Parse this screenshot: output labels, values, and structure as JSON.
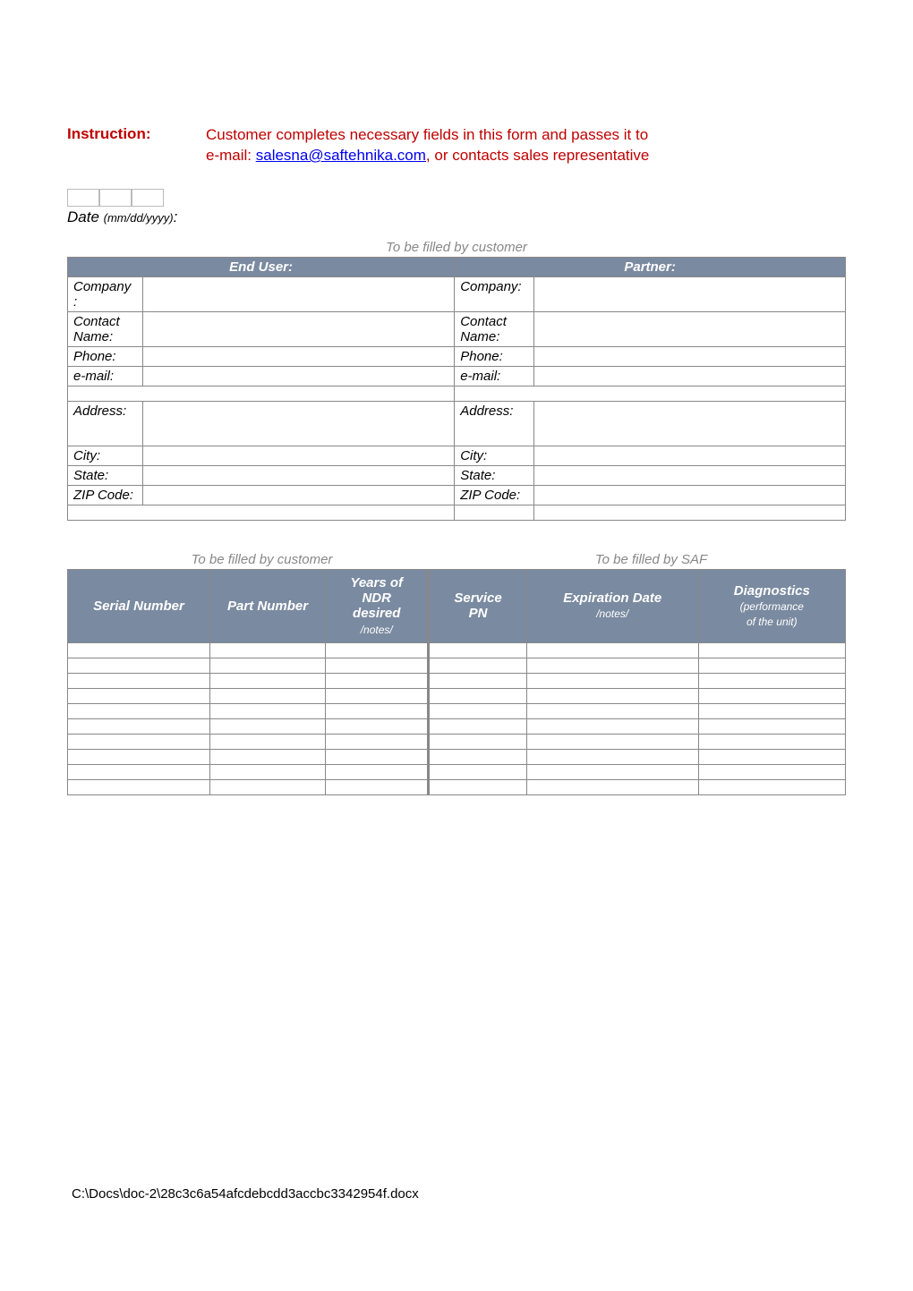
{
  "instruction": {
    "label": "Instruction:",
    "line1_prefix": "Customer completes necessary fields in this form and passes it to",
    "line2_prefix": "e-mail: ",
    "email": "salesna@saftehnika.com",
    "line2_suffix": ", or contacts sales representative"
  },
  "date": {
    "label": "Date ",
    "sub": "(mm/dd/yyyy)",
    "colon": ":"
  },
  "notes": {
    "customer": "To be filled by customer",
    "saf": "To be filled by SAF"
  },
  "contact": {
    "end_user_header": "End User:",
    "partner_header": "Partner:",
    "labels": {
      "company_colon": "Company:",
      "company_split": "Company :",
      "contact_name": "Contact Name:",
      "phone": "Phone:",
      "email": "e-mail:",
      "address": "Address:",
      "city": "City:",
      "state": "State:",
      "zip": "ZIP Code:"
    }
  },
  "items": {
    "headers": {
      "serial": "Serial Number",
      "part": "Part Number",
      "years_l1": "Years of",
      "years_l2": "NDR",
      "years_l3": "desired",
      "years_sub": "/notes/",
      "service_l1": "Service",
      "service_l2": "PN",
      "expiration": "Expiration Date",
      "expiration_sub": "/notes/",
      "diag_l1": "Diagnostics",
      "diag_l2": "(performance",
      "diag_l3": "of the unit)"
    }
  },
  "footer_path": "C:\\Docs\\doc-2\\28c3c6a54afcdebcdd3accbc3342954f.docx"
}
